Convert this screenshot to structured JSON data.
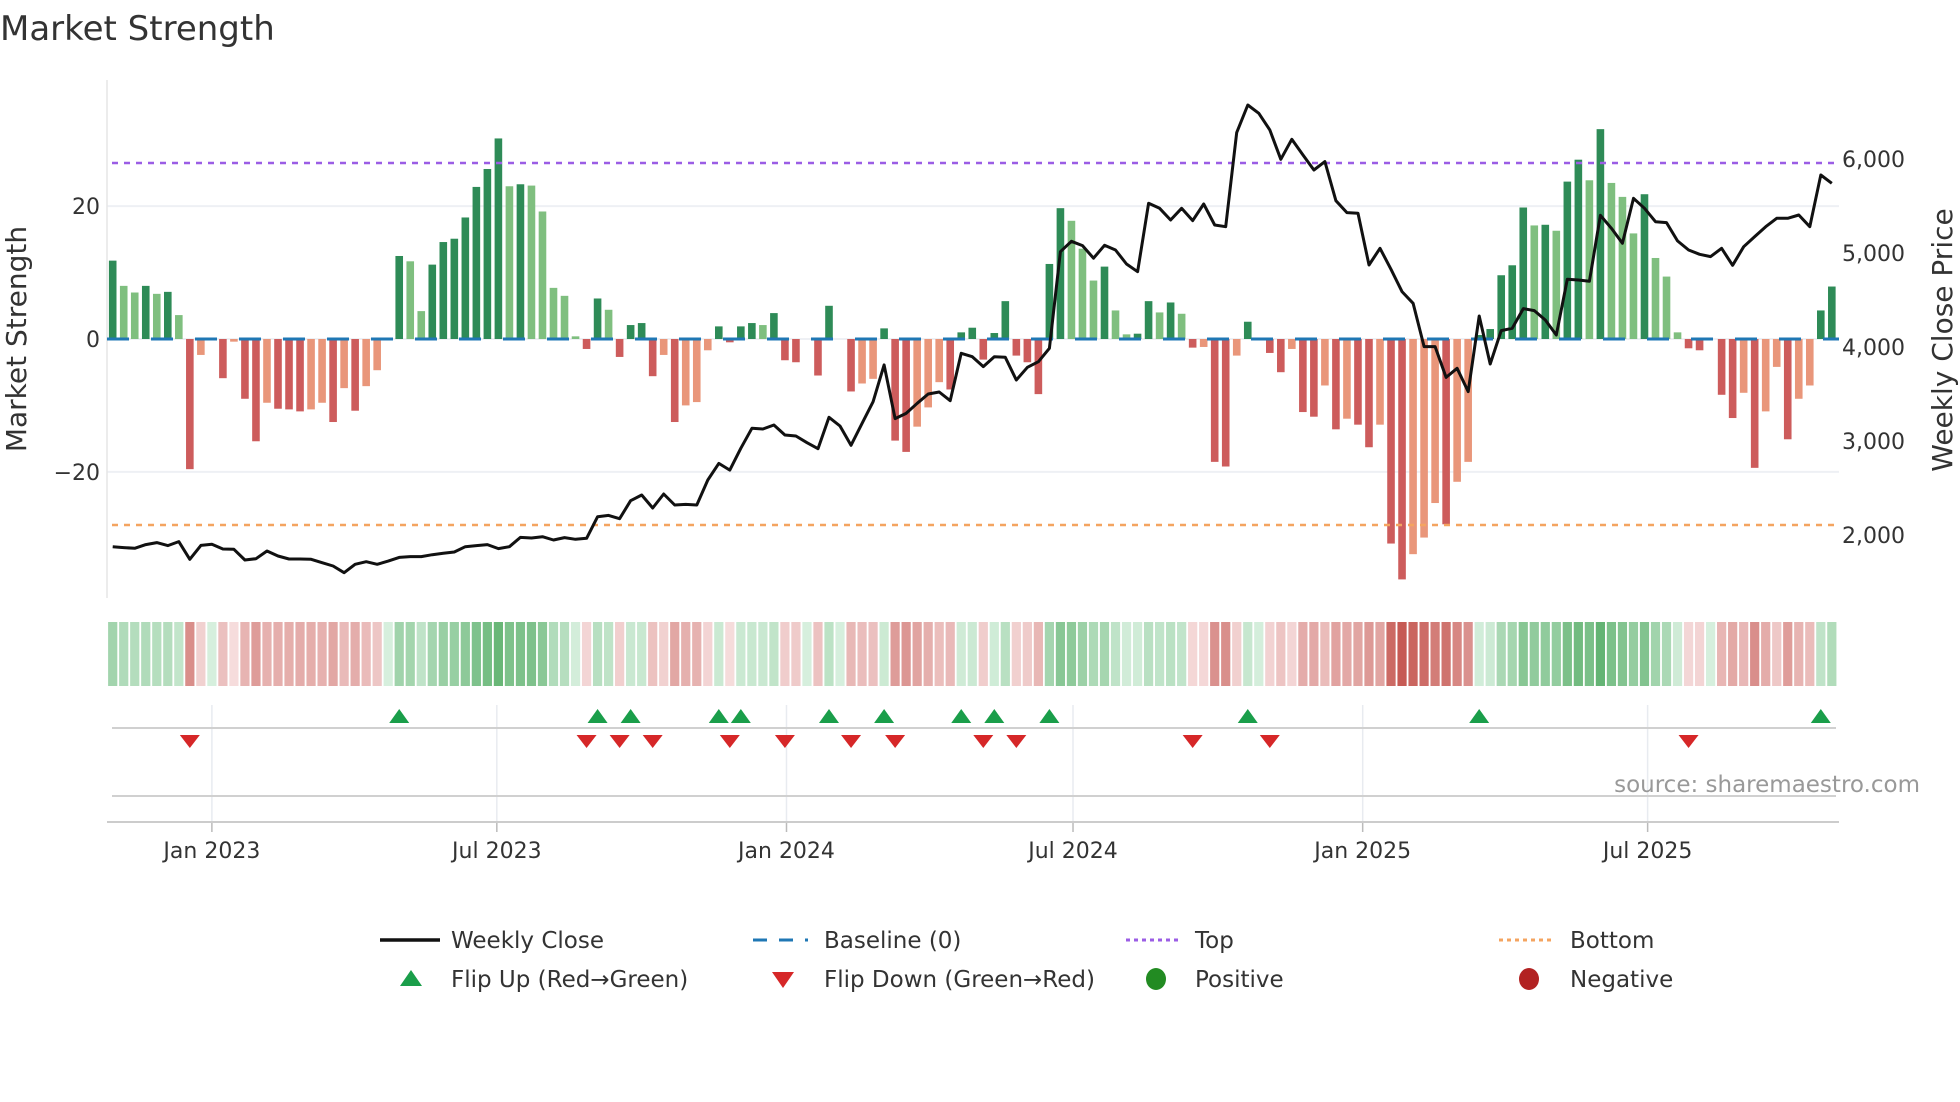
{
  "title": "Market Strength",
  "source": "source: sharemaestro.com",
  "colors": {
    "pos_strong": "#2e8b57",
    "pos_weak": "#7fbf7f",
    "neg_strong": "#cd5c5c",
    "neg_weak": "#e9967a",
    "baseline": "#1f77b4",
    "top": "#9b5de5",
    "bottom": "#f4a460",
    "line": "#111111",
    "flip_up": "#1a9e4a",
    "flip_down": "#d62728",
    "positive": "#228b22",
    "negative": "#b22222"
  },
  "legend": {
    "weekly_close": "Weekly Close",
    "baseline": "Baseline (0)",
    "top": "Top",
    "bottom": "Bottom",
    "flip_up": "Flip Up (Red→Green)",
    "flip_down": "Flip Down (Green→Red)",
    "positive": "Positive",
    "negative": "Negative"
  },
  "chart_data": {
    "type": "bar",
    "title": "Market Strength",
    "x_start": "2022-10-30",
    "x_step_days": 7,
    "left_axis": {
      "label": "Market Strength",
      "range": [
        -39,
        39
      ],
      "ticks": [
        20,
        0,
        -20
      ],
      "tick_labels": [
        "20",
        "0",
        "−20"
      ]
    },
    "right_axis": {
      "label": "Weekly Close Price",
      "range": [
        1330,
        6840
      ],
      "ticks": [
        6000,
        5000,
        4000,
        3000,
        2000
      ],
      "tick_labels": [
        "6,000",
        "5,000",
        "4,000",
        "3,000",
        "2,000"
      ]
    },
    "x_ticks": [
      {
        "label": "Jan 2023",
        "date": "2023-01-01"
      },
      {
        "label": "Jul 2023",
        "date": "2023-07-01"
      },
      {
        "label": "Jan 2024",
        "date": "2024-01-01"
      },
      {
        "label": "Jul 2024",
        "date": "2024-07-01"
      },
      {
        "label": "Jan 2025",
        "date": "2025-01-01"
      },
      {
        "label": "Jul 2025",
        "date": "2025-07-01"
      }
    ],
    "top_level": 26.5,
    "bottom_level": -28,
    "baseline": 0,
    "strength": [
      11.8,
      8.0,
      7.0,
      8.0,
      6.8,
      7.1,
      3.6,
      -19.6,
      -2.4,
      0,
      -5.9,
      -0.4,
      -9.0,
      -15.4,
      -9.6,
      -10.5,
      -10.6,
      -10.9,
      -10.6,
      -9.6,
      -12.5,
      -7.4,
      -10.8,
      -7.1,
      -4.7,
      0,
      12.5,
      11.7,
      4.2,
      11.2,
      14.6,
      15.1,
      18.3,
      22.9,
      25.6,
      30.2,
      23.0,
      23.3,
      23.1,
      19.2,
      7.7,
      6.5,
      0.4,
      -1.5,
      6.1,
      4.4,
      -2.7,
      2.1,
      2.4,
      -5.6,
      -2.4,
      -12.5,
      -10.0,
      -9.5,
      -1.7,
      1.9,
      -0.5,
      1.9,
      2.4,
      2.1,
      3.9,
      -3.2,
      -3.5,
      0,
      -5.5,
      5.0,
      0,
      -7.9,
      -6.7,
      -6.0,
      1.6,
      -15.3,
      -17.0,
      -13.2,
      -10.3,
      -6.5,
      -7.6,
      1.0,
      1.7,
      -3.1,
      0.9,
      5.7,
      -2.5,
      -3.5,
      -8.3,
      11.3,
      19.7,
      17.8,
      13.6,
      8.8,
      10.9,
      4.3,
      0.7,
      0.8,
      5.7,
      4.0,
      5.5,
      3.8,
      -1.3,
      -1.2,
      -18.5,
      -19.2,
      -2.5,
      2.6,
      0.2,
      -2.1,
      -5.0,
      -1.5,
      -11.0,
      -11.7,
      -7.0,
      -13.6,
      -12.0,
      -12.9,
      -16.3,
      -12.9,
      -30.8,
      -36.2,
      -32.4,
      -29.9,
      -24.7,
      -27.9,
      -21.5,
      -18.5,
      0.6,
      1.5,
      9.6,
      11.1,
      19.8,
      17.1,
      17.2,
      16.3,
      23.7,
      27.0,
      23.9,
      31.6,
      23.5,
      21.4,
      15.9,
      21.8,
      12.2,
      9.4,
      1.0,
      -1.4,
      -1.7,
      0,
      -8.4,
      -11.9,
      -8.1,
      -19.4,
      -10.9,
      -4.2,
      -15.1,
      -9.0,
      -7.0,
      4.3,
      7.9
    ],
    "weekly_close": [
      1876,
      1866,
      1859,
      1898,
      1919,
      1887,
      1930,
      1742,
      1890,
      1901,
      1851,
      1848,
      1734,
      1748,
      1830,
      1777,
      1745,
      1745,
      1742,
      1706,
      1670,
      1599,
      1688,
      1716,
      1688,
      1723,
      1762,
      1770,
      1770,
      1791,
      1805,
      1819,
      1876,
      1887,
      1898,
      1855,
      1876,
      1975,
      1968,
      1982,
      1947,
      1972,
      1954,
      1965,
      2195,
      2209,
      2174,
      2365,
      2426,
      2287,
      2436,
      2319,
      2326,
      2319,
      2585,
      2762,
      2691,
      2922,
      3135,
      3128,
      3170,
      3064,
      3053,
      2982,
      2918,
      3252,
      3160,
      2954,
      3188,
      3418,
      3809,
      3238,
      3294,
      3401,
      3500,
      3521,
      3429,
      3933,
      3897,
      3791,
      3897,
      3890,
      3649,
      3784,
      3844,
      3986,
      5014,
      5124,
      5078,
      4944,
      5082,
      5032,
      4883,
      4801,
      5528,
      5475,
      5351,
      5475,
      5344,
      5521,
      5298,
      5280,
      6280,
      6574,
      6486,
      6309,
      5996,
      6209,
      6043,
      5883,
      5972,
      5556,
      5429,
      5422,
      4872,
      5050,
      4826,
      4589,
      4465,
      4004,
      4004,
      3677,
      3773,
      3525,
      4330,
      3819,
      4174,
      4199,
      4408,
      4387,
      4287,
      4128,
      4720,
      4713,
      4699,
      5401,
      5262,
      5103,
      5582,
      5475,
      5333,
      5323,
      5128,
      5032,
      4986,
      4961,
      5050,
      4869,
      5067,
      5174,
      5280,
      5369,
      5369,
      5404,
      5280,
      5830,
      5741
    ]
  }
}
